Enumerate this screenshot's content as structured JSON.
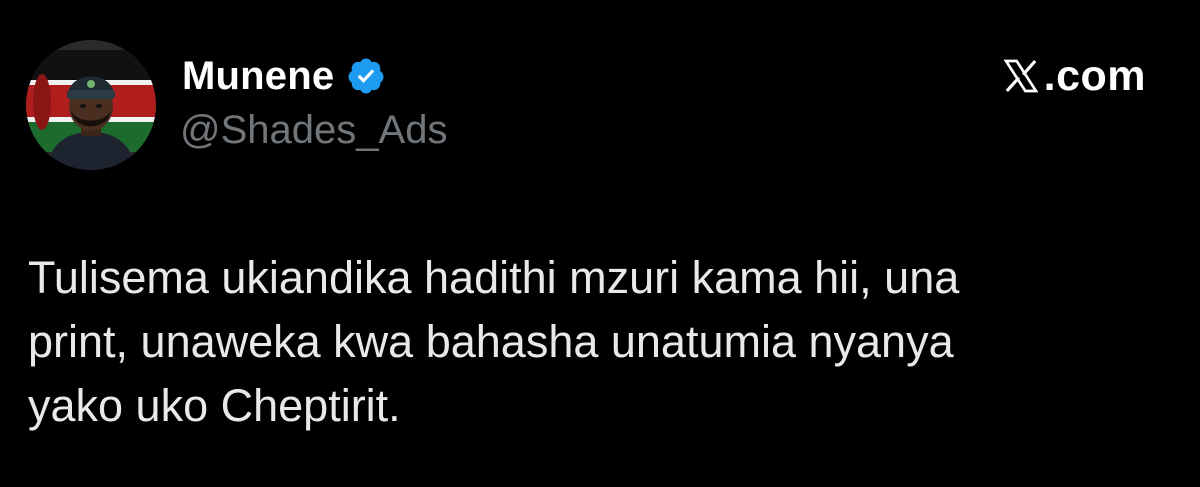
{
  "author": {
    "display_name": "Munene",
    "handle": "@Shades_Ads",
    "verified": true,
    "avatar_icon": "avatar-portrait-kenya-flag",
    "verified_icon": "verified-badge-icon"
  },
  "source": {
    "logo_icon": "x-logo-icon",
    "domain": ".com"
  },
  "tweet": {
    "text": "Tulisema ukiandika hadithi mzuri kama hii, una\nprint, unaweka kwa bahasha unatumia nyanya\nyako uko Cheptirit."
  },
  "colors": {
    "background": "#000000",
    "text_primary": "#e7e9ea",
    "text_secondary": "#71767b",
    "verified_blue": "#1d9bf0"
  }
}
